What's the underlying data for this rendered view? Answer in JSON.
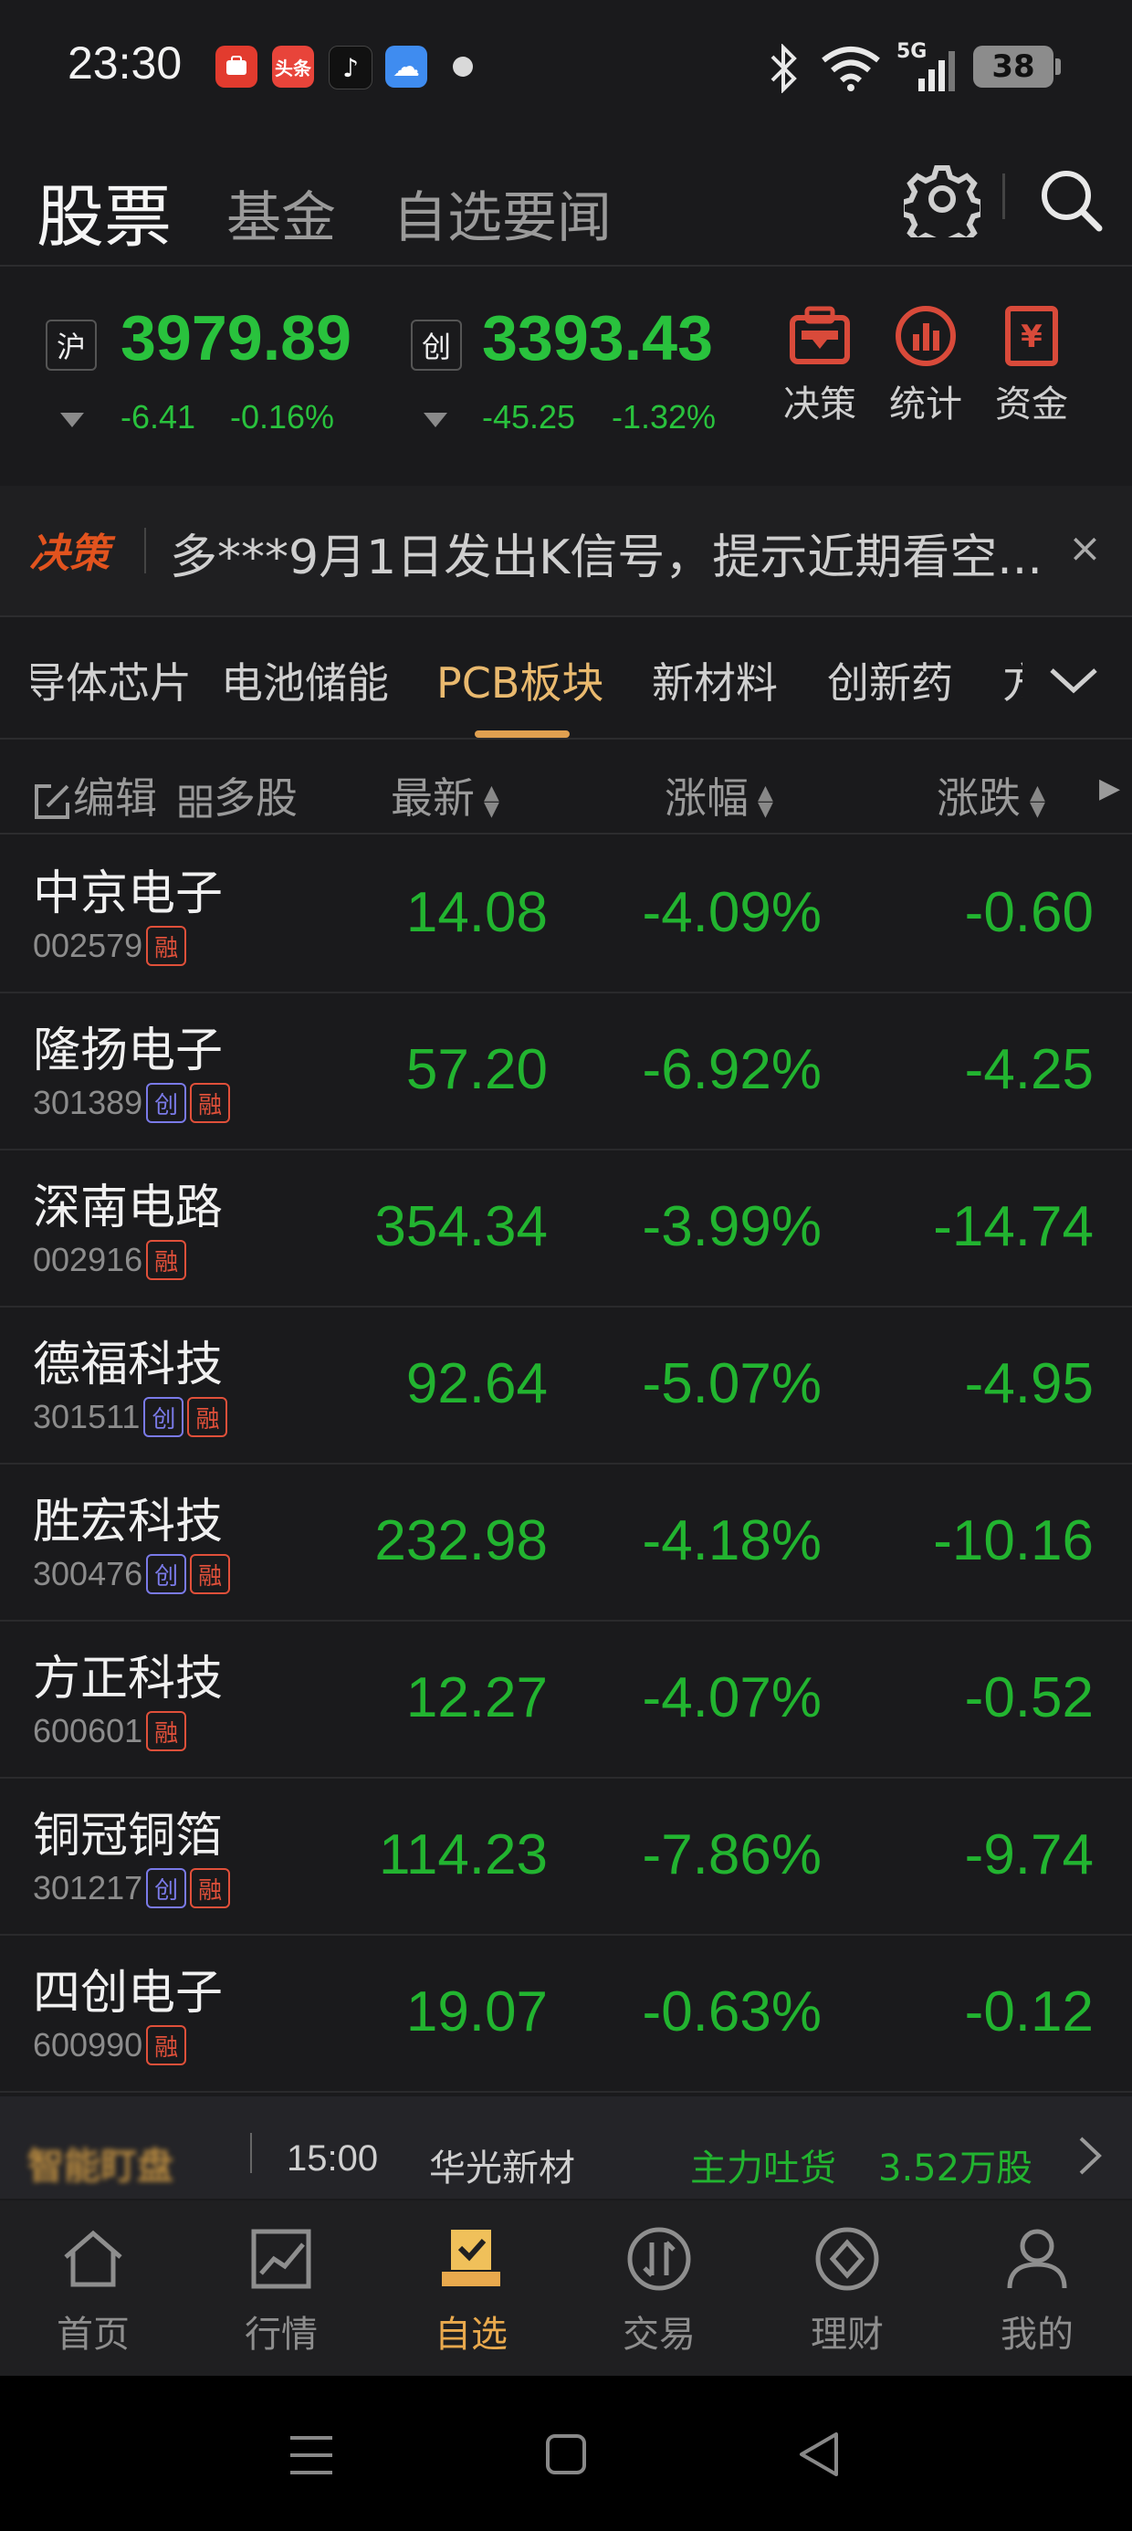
{
  "status_bar": {
    "time": "23:30",
    "apps": [
      {
        "icon": "app-store-icon",
        "label": "",
        "color": "#e23b2e"
      },
      {
        "icon": "toutiao-icon",
        "label": "头条",
        "color": "#e8443a"
      },
      {
        "icon": "tiktok-icon",
        "label": "♪",
        "color": "#111111"
      },
      {
        "icon": "weather-icon",
        "label": "☁",
        "color": "#3f8cf0"
      }
    ],
    "network": "5G",
    "battery": "38"
  },
  "top_tabs": [
    {
      "label": "股票",
      "active": true
    },
    {
      "label": "基金",
      "active": false
    },
    {
      "label": "自选要闻",
      "active": false
    }
  ],
  "indices": [
    {
      "badge": "沪",
      "value": "3979.89",
      "change": "-6.41",
      "pct": "-0.16%"
    },
    {
      "badge": "创",
      "value": "3393.43",
      "change": "-45.25",
      "pct": "-1.32%"
    }
  ],
  "tools": [
    {
      "label": "决策",
      "icon": "decision-icon"
    },
    {
      "label": "统计",
      "icon": "stats-icon"
    },
    {
      "label": "资金",
      "icon": "funds-icon"
    }
  ],
  "news": {
    "brand": "决策",
    "text": "多***9月1日发出K信号，提示近期看空...",
    "close": "×"
  },
  "categories": [
    {
      "label": "导体芯片",
      "active": false
    },
    {
      "label": "电池储能",
      "active": false
    },
    {
      "label": "PCB板块",
      "active": true
    },
    {
      "label": "新材料",
      "active": false
    },
    {
      "label": "创新药",
      "active": false
    },
    {
      "label": "方",
      "active": false
    }
  ],
  "list_header": {
    "edit": "编辑",
    "multi": "多股",
    "col_price": "最新",
    "col_pct": "涨幅",
    "col_chg": "涨跌"
  },
  "stocks": [
    {
      "name": "中京电子",
      "code": "002579",
      "tags": [
        "融"
      ],
      "price": "14.08",
      "pct": "-4.09%",
      "chg": "-0.60"
    },
    {
      "name": "隆扬电子",
      "code": "301389",
      "tags": [
        "创",
        "融"
      ],
      "price": "57.20",
      "pct": "-6.92%",
      "chg": "-4.25"
    },
    {
      "name": "深南电路",
      "code": "002916",
      "tags": [
        "融"
      ],
      "price": "354.34",
      "pct": "-3.99%",
      "chg": "-14.74"
    },
    {
      "name": "德福科技",
      "code": "301511",
      "tags": [
        "创",
        "融"
      ],
      "price": "92.64",
      "pct": "-5.07%",
      "chg": "-4.95"
    },
    {
      "name": "胜宏科技",
      "code": "300476",
      "tags": [
        "创",
        "融"
      ],
      "price": "232.98",
      "pct": "-4.18%",
      "chg": "-10.16"
    },
    {
      "name": "方正科技",
      "code": "600601",
      "tags": [
        "融"
      ],
      "price": "12.27",
      "pct": "-4.07%",
      "chg": "-0.52"
    },
    {
      "name": "铜冠铜箔",
      "code": "301217",
      "tags": [
        "创",
        "融"
      ],
      "price": "114.23",
      "pct": "-7.86%",
      "chg": "-9.74"
    },
    {
      "name": "四创电子",
      "code": "600990",
      "tags": [
        "融"
      ],
      "price": "19.07",
      "pct": "-0.63%",
      "chg": "-0.12"
    }
  ],
  "ticker": {
    "brand": "智能盯盘",
    "time": "15:00",
    "stock": "华光新材",
    "action": "主力吐货",
    "amount": "3.52万股"
  },
  "bottom_nav": [
    {
      "label": "首页",
      "icon": "home-icon",
      "active": false
    },
    {
      "label": "行情",
      "icon": "market-icon",
      "active": false
    },
    {
      "label": "自选",
      "icon": "watchlist-icon",
      "active": true
    },
    {
      "label": "交易",
      "icon": "trade-icon",
      "active": false
    },
    {
      "label": "理财",
      "icon": "wealth-icon",
      "active": false
    },
    {
      "label": "我的",
      "icon": "profile-icon",
      "active": false
    }
  ],
  "colors": {
    "down": "#22b430",
    "accent": "#e9a94d",
    "brand": "#e2531e"
  }
}
